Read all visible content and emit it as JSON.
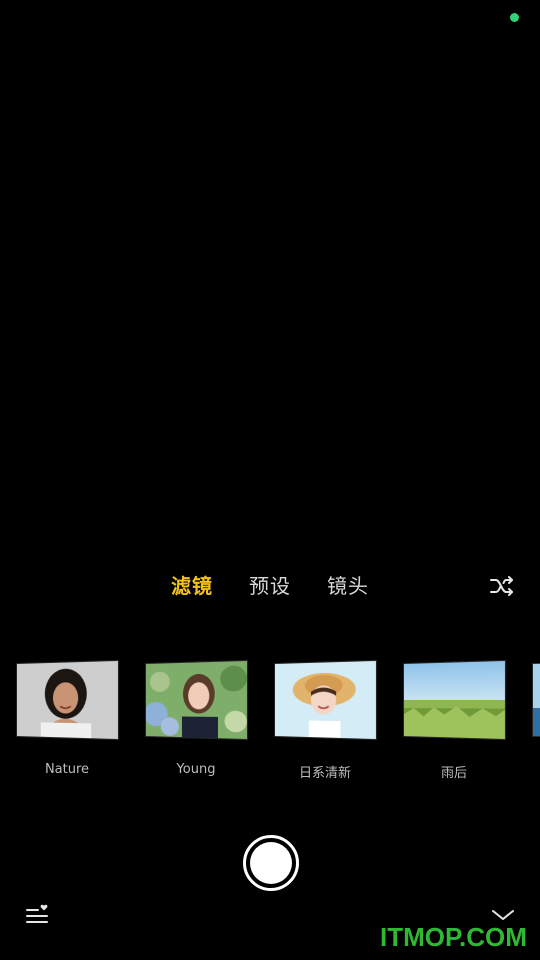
{
  "tabs": [
    {
      "label": "滤镜",
      "active": true
    },
    {
      "label": "预设",
      "active": false
    },
    {
      "label": "镜头",
      "active": false
    }
  ],
  "filters": [
    {
      "label": "Nature"
    },
    {
      "label": "Young"
    },
    {
      "label": "日系清新"
    },
    {
      "label": "雨后"
    },
    {
      "label": ""
    }
  ],
  "icons": {
    "shuffle": "shuffle-icon",
    "favorites_list": "favorites-list-icon",
    "collapse": "chevron-down-icon"
  },
  "watermark": "ITMOP.COM",
  "colors": {
    "background": "#000000",
    "active_tab": "#f2c21a",
    "inactive_tab": "#d8d8d8",
    "status_dot": "#33d17a",
    "watermark": "#2fb834"
  }
}
